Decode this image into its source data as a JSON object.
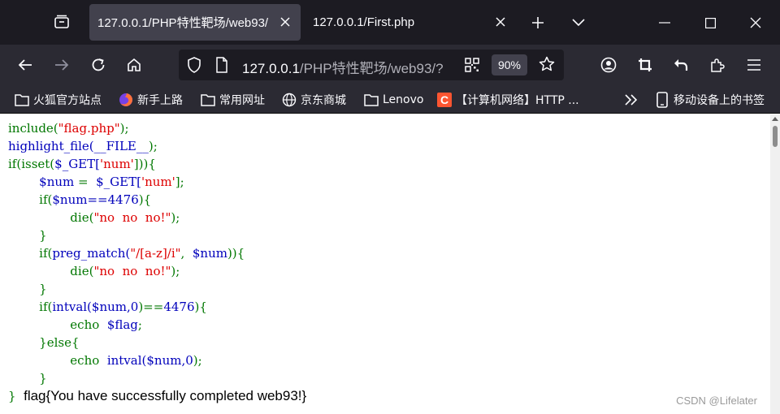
{
  "tabs": [
    {
      "title": "127.0.0.1/PHP特性靶场/web93/"
    },
    {
      "title": "127.0.0.1/First.php"
    }
  ],
  "url": {
    "host": "127.0.0.1",
    "path": "/PHP特性靶场/web93/?",
    "zoom": "90%"
  },
  "bookmarks": [
    {
      "label": "火狐官方站点",
      "icon": "folder-icon"
    },
    {
      "label": "新手上路",
      "icon": "firefox-icon"
    },
    {
      "label": "常用网址",
      "icon": "folder-icon"
    },
    {
      "label": "京东商城",
      "icon": "globe-icon"
    },
    {
      "label": "Lenovo",
      "icon": "folder-icon"
    },
    {
      "label": "【计算机网络】HTTP ...",
      "icon": "csdn-icon"
    },
    {
      "label": "移动设备上的书签",
      "icon": "mobile-icon"
    }
  ],
  "code": {
    "l1_fn": "include(",
    "l1_str": "\"flag.php\"",
    "l1_end": ");",
    "l2_fn": "highlight_file(",
    "l2_const": "__FILE__",
    "l2_end": ");",
    "l3_a": "if(isset(",
    "l3_var": "$_GET[",
    "l3_key": "'num'",
    "l3_end": "])){",
    "l4_var": "$num",
    "l4_eq": " = ",
    "l4_get": "$_GET[",
    "l4_key": "'num'",
    "l4_end": "];",
    "l5_if": "if(",
    "l5_cond": "$num==4476",
    "l5_end": "){",
    "l6_die": "die(",
    "l6_str": "\"no  no  no!\"",
    "l6_end": ");",
    "close": "}",
    "l8_if": "if(",
    "l8_fn": "preg_match(",
    "l8_str": "\"/[a-z]/i\"",
    "l8_comma": ",  ",
    "l8_var": "$num",
    "l8_end": ")){",
    "l11_if": "if(",
    "l11_fn": "intval(",
    "l11_args": "$num,0",
    "l11_cmp": ")==",
    "l11_num": "4476",
    "l11_end": "){",
    "l12_echo": "echo  ",
    "l12_var": "$flag",
    "l12_end": ";",
    "l13_else": "}else{",
    "l14_echo": "echo  ",
    "l14_fn": "intval(",
    "l14_args": "$num,0",
    "l14_end": ");",
    "last_brace": "}",
    "output": "flag{You have successfully completed web93!}"
  },
  "watermark": "CSDN @Lifelater"
}
